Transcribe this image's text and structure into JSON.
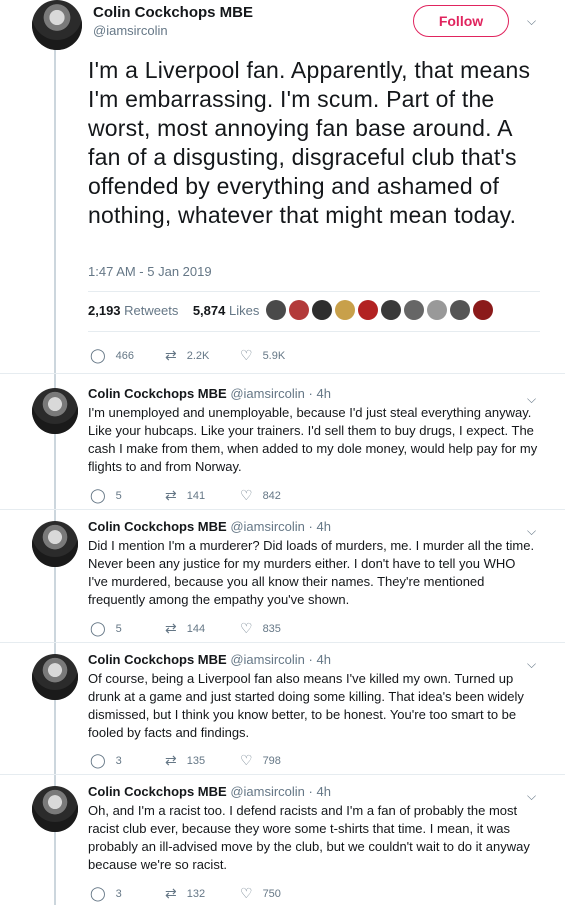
{
  "main": {
    "name": "Colin Cockchops MBE",
    "handle": "@iamsircolin",
    "follow_label": "Follow",
    "text": "I'm a Liverpool fan. Apparently, that means I'm embarrassing. I'm scum. Part of the worst, most annoying fan base around. A fan of a disgusting, disgraceful club that's offended by everything and ashamed of nothing, whatever that might mean today.",
    "timestamp": "1:47 AM - 5 Jan 2019",
    "retweets": "2,193",
    "retweets_label": "Retweets",
    "likes": "5,874",
    "likes_label": "Likes",
    "replies_count": "466",
    "retweet_count": "2.2K",
    "like_count": "5.9K"
  },
  "replies": [
    {
      "name": "Colin Cockchops MBE",
      "meta": "@iamsircolin · 4h",
      "text": "I'm unemployed and unemployable, because I'd just steal everything anyway. Like your hubcaps. Like your trainers. I'd sell them to buy drugs, I expect. The cash I make from them, when added to my dole money, would help pay for my flights to and from Norway.",
      "replies": "5",
      "retweets": "141",
      "likes": "842"
    },
    {
      "name": "Colin Cockchops MBE",
      "meta": "@iamsircolin · 4h",
      "text": "Did I mention I'm a murderer? Did loads of murders, me. I murder all the time. Never been any justice for my murders either. I don't have to tell you WHO I've murdered, because you all know their names. They're mentioned frequently among the empathy you've shown.",
      "replies": "5",
      "retweets": "144",
      "likes": "835"
    },
    {
      "name": "Colin Cockchops MBE",
      "meta": "@iamsircolin · 4h",
      "text": "Of course, being a Liverpool fan also means I've killed my own. Turned up drunk at a game and just started doing some killing. That idea's been widely dismissed, but I think you know better, to be honest. You're too smart to be fooled by facts and findings.",
      "replies": "3",
      "retweets": "135",
      "likes": "798"
    },
    {
      "name": "Colin Cockchops MBE",
      "meta": "@iamsircolin · 4h",
      "text": "Oh, and I'm a racist too. I defend racists and I'm a fan of probably the most racist club ever, because they wore some t-shirts that time. I mean, it was probably an ill-advised move by the club, but we couldn't wait to do it anyway because we're so racist.",
      "replies": "3",
      "retweets": "132",
      "likes": "750"
    }
  ],
  "colors": {
    "accent": "#e0245e",
    "muted": "#657786",
    "text": "#14171a"
  },
  "icons": {
    "reply": "reply-icon",
    "retweet": "retweet-icon",
    "like": "heart-icon",
    "caret": "chevron-down-icon"
  }
}
